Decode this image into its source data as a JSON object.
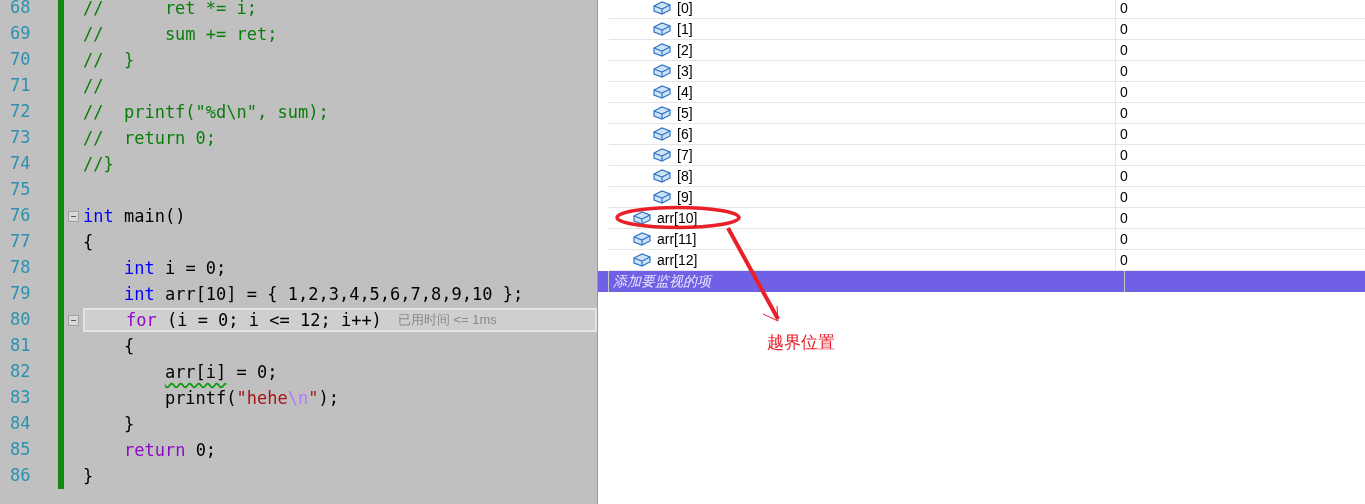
{
  "editor": {
    "lines": [
      {
        "number": "68",
        "collapsible": false,
        "highlighted": false,
        "tokens": [
          {
            "kind": "comment",
            "text": "//      ret *= i;"
          }
        ]
      },
      {
        "number": "69",
        "collapsible": false,
        "highlighted": false,
        "tokens": [
          {
            "kind": "comment",
            "text": "//      sum += ret;"
          }
        ]
      },
      {
        "number": "70",
        "collapsible": false,
        "highlighted": false,
        "tokens": [
          {
            "kind": "comment",
            "text": "//  }"
          }
        ]
      },
      {
        "number": "71",
        "collapsible": false,
        "highlighted": false,
        "tokens": [
          {
            "kind": "comment",
            "text": "//"
          }
        ]
      },
      {
        "number": "72",
        "collapsible": false,
        "highlighted": false,
        "tokens": [
          {
            "kind": "comment",
            "text": "//  printf(\"%d\\n\", sum);"
          }
        ]
      },
      {
        "number": "73",
        "collapsible": false,
        "highlighted": false,
        "tokens": [
          {
            "kind": "comment",
            "text": "//  return 0;"
          }
        ]
      },
      {
        "number": "74",
        "collapsible": false,
        "highlighted": false,
        "tokens": [
          {
            "kind": "comment",
            "text": "//}"
          }
        ]
      },
      {
        "number": "75",
        "collapsible": false,
        "highlighted": false
      },
      {
        "number": "76",
        "collapsible": true,
        "highlighted": false,
        "tokens": [
          {
            "kind": "keyword",
            "text": "int"
          },
          {
            "kind": "plain",
            "text": " main()"
          }
        ]
      },
      {
        "number": "77",
        "collapsible": false,
        "highlighted": false,
        "tokens": [
          {
            "kind": "plain",
            "text": "{"
          }
        ]
      },
      {
        "number": "78",
        "collapsible": false,
        "highlighted": false,
        "tokens": [
          {
            "kind": "keyword",
            "text": "    int"
          },
          {
            "kind": "plain",
            "text": " i = 0;"
          }
        ]
      },
      {
        "number": "79",
        "collapsible": false,
        "highlighted": false,
        "tokens": [
          {
            "kind": "keyword",
            "text": "    int"
          },
          {
            "kind": "plain",
            "text": " arr[10] = { 1,2,3,4,5,6,7,8,9,10 };"
          }
        ]
      },
      {
        "number": "80",
        "collapsible": true,
        "highlighted": true,
        "hint": "已用时间 <= 1ms",
        "tokens": [
          {
            "kind": "control",
            "text": "    for"
          },
          {
            "kind": "plain",
            "text": " (i = 0; i <= 12; i++)"
          }
        ]
      },
      {
        "number": "81",
        "collapsible": false,
        "highlighted": false,
        "tokens": [
          {
            "kind": "plain",
            "text": "    {"
          }
        ]
      },
      {
        "number": "82",
        "collapsible": false,
        "highlighted": false,
        "tokens": [
          {
            "kind": "squiggle",
            "text": "        arr[i]"
          },
          {
            "kind": "plain",
            "text": " = 0;"
          }
        ]
      },
      {
        "number": "83",
        "collapsible": false,
        "highlighted": false,
        "tokens": [
          {
            "kind": "plain",
            "text": "        printf("
          },
          {
            "kind": "string",
            "text": "\"hehe"
          },
          {
            "kind": "escape",
            "text": "\\n"
          },
          {
            "kind": "string",
            "text": "\""
          },
          {
            "kind": "plain",
            "text": ");"
          }
        ]
      },
      {
        "number": "84",
        "collapsible": false,
        "highlighted": false,
        "tokens": [
          {
            "kind": "plain",
            "text": "    }"
          }
        ]
      },
      {
        "number": "85",
        "collapsible": false,
        "highlighted": false,
        "tokens": [
          {
            "kind": "control",
            "text": "    return"
          },
          {
            "kind": "plain",
            "text": " 0;"
          }
        ]
      },
      {
        "number": "86",
        "collapsible": false,
        "highlighted": false,
        "tokens": [
          {
            "kind": "plain",
            "text": "}"
          }
        ]
      }
    ]
  },
  "watch": {
    "child_rows": [
      {
        "name": "[0]",
        "value": "0"
      },
      {
        "name": "[1]",
        "value": "0"
      },
      {
        "name": "[2]",
        "value": "0"
      },
      {
        "name": "[3]",
        "value": "0"
      },
      {
        "name": "[4]",
        "value": "0"
      },
      {
        "name": "[5]",
        "value": "0"
      },
      {
        "name": "[6]",
        "value": "0"
      },
      {
        "name": "[7]",
        "value": "0"
      },
      {
        "name": "[8]",
        "value": "0"
      },
      {
        "name": "[9]",
        "value": "0"
      }
    ],
    "rows": [
      {
        "name": "arr[10]",
        "value": "0"
      },
      {
        "name": "arr[11]",
        "value": "0"
      },
      {
        "name": "arr[12]",
        "value": "0"
      }
    ],
    "add_row": {
      "placeholder": "添加要监视的项"
    }
  },
  "annotation": {
    "text": "越界位置"
  }
}
